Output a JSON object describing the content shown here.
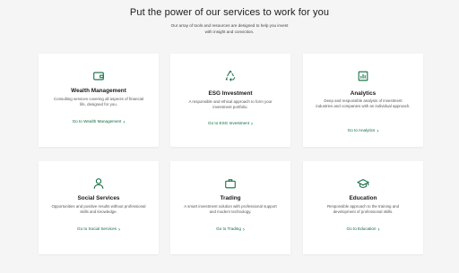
{
  "header": {
    "title": "Put the power of our services to work for you",
    "subtitle": "Our array of tools and resources are designed to help you invest with insight and conviction."
  },
  "colors": {
    "accent": "#0e6b3e",
    "background": "#f4f5f4",
    "card": "#ffffff"
  },
  "cards": [
    {
      "icon": "wallet-icon",
      "title": "Wealth Management",
      "desc": "Consulting services covering all aspects of financial life, designed for you.",
      "link": "Go to Wealth Management"
    },
    {
      "icon": "recycle-icon",
      "title": "ESG Investment",
      "desc": "A responsible and ethical approach to form your investment portfolio.",
      "link": "Go to ESG Investment"
    },
    {
      "icon": "bar-chart-icon",
      "title": "Analytics",
      "desc": "Deep and responsible analysis of investment industries and companies with an individual approach.",
      "link": "Go to Analytics"
    },
    {
      "icon": "person-icon",
      "title": "Social Services",
      "desc": "Opportunities and positive results without professional skills and knowledge.",
      "link": "Go to Social Services"
    },
    {
      "icon": "briefcase-icon",
      "title": "Trading",
      "desc": "A smart investment solution with professional support and modern technology.",
      "link": "Go to Trading"
    },
    {
      "icon": "graduation-cap-icon",
      "title": "Education",
      "desc": "Responsible approach to the training and development of professional skills.",
      "link": "Go to Education"
    }
  ]
}
